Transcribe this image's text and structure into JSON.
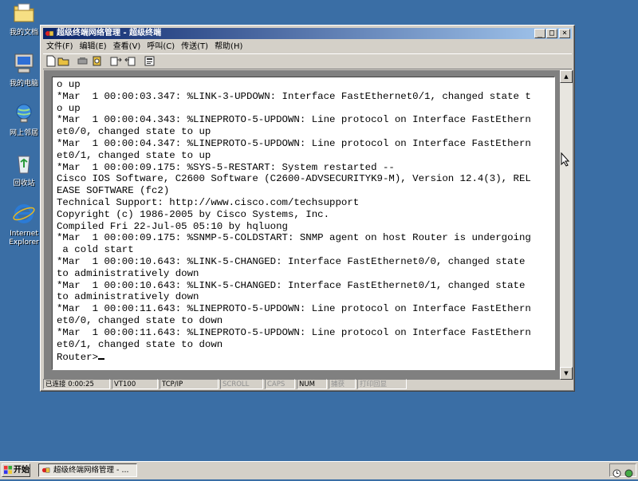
{
  "desktop": {
    "icons": [
      {
        "label": "我的文档",
        "icon": "my-documents-icon"
      },
      {
        "label": "我的电脑",
        "icon": "my-computer-icon"
      },
      {
        "label": "网上邻居",
        "icon": "network-places-icon"
      },
      {
        "label": "回收站",
        "icon": "recycle-bin-icon"
      },
      {
        "label": "Internet\nExplorer",
        "icon": "internet-explorer-icon"
      }
    ],
    "background_color": "#3a6ea5"
  },
  "window": {
    "title": "超级终端网络管理 - 超级终端",
    "controls": {
      "minimize": "_",
      "restore": "□",
      "close": "×"
    },
    "menu": [
      "文件(F)",
      "编辑(E)",
      "查看(V)",
      "呼叫(C)",
      "传送(T)",
      "帮助(H)"
    ],
    "toolbar_icons": [
      "new-icon",
      "open-icon",
      "disconnect-icon",
      "call-icon",
      "send-icon",
      "receive-icon",
      "properties-icon"
    ],
    "terminal_lines": [
      "o up",
      "*Mar  1 00:00:03.347: %LINK-3-UPDOWN: Interface FastEthernet0/1, changed state t",
      "o up",
      "*Mar  1 00:00:04.343: %LINEPROTO-5-UPDOWN: Line protocol on Interface FastEthern",
      "et0/0, changed state to up",
      "*Mar  1 00:00:04.347: %LINEPROTO-5-UPDOWN: Line protocol on Interface FastEthern",
      "et0/1, changed state to up",
      "*Mar  1 00:00:09.175: %SYS-5-RESTART: System restarted --",
      "Cisco IOS Software, C2600 Software (C2600-ADVSECURITYK9-M), Version 12.4(3), REL",
      "EASE SOFTWARE (fc2)",
      "Technical Support: http://www.cisco.com/techsupport",
      "Copyright (c) 1986-2005 by Cisco Systems, Inc.",
      "Compiled Fri 22-Jul-05 05:10 by hqluong",
      "*Mar  1 00:00:09.175: %SNMP-5-COLDSTART: SNMP agent on host Router is undergoing",
      " a cold start",
      "*Mar  1 00:00:10.643: %LINK-5-CHANGED: Interface FastEthernet0/0, changed state",
      "to administratively down",
      "*Mar  1 00:00:10.643: %LINK-5-CHANGED: Interface FastEthernet0/1, changed state",
      "to administratively down",
      "*Mar  1 00:00:11.643: %LINEPROTO-5-UPDOWN: Line protocol on Interface FastEthern",
      "et0/0, changed state to down",
      "*Mar  1 00:00:11.643: %LINEPROTO-5-UPDOWN: Line protocol on Interface FastEthern",
      "et0/1, changed state to down"
    ],
    "prompt": "Router>",
    "status": {
      "connected": "已连接 0:00:25",
      "emulation": "VT100",
      "protocol": "TCP/IP",
      "scroll": "SCROLL",
      "caps": "CAPS",
      "num": "NUM",
      "capture": "捕获",
      "print_echo": "打印回显"
    }
  },
  "taskbar": {
    "start_label": "开始",
    "task_label": "超级终端网络管理 - ..."
  }
}
